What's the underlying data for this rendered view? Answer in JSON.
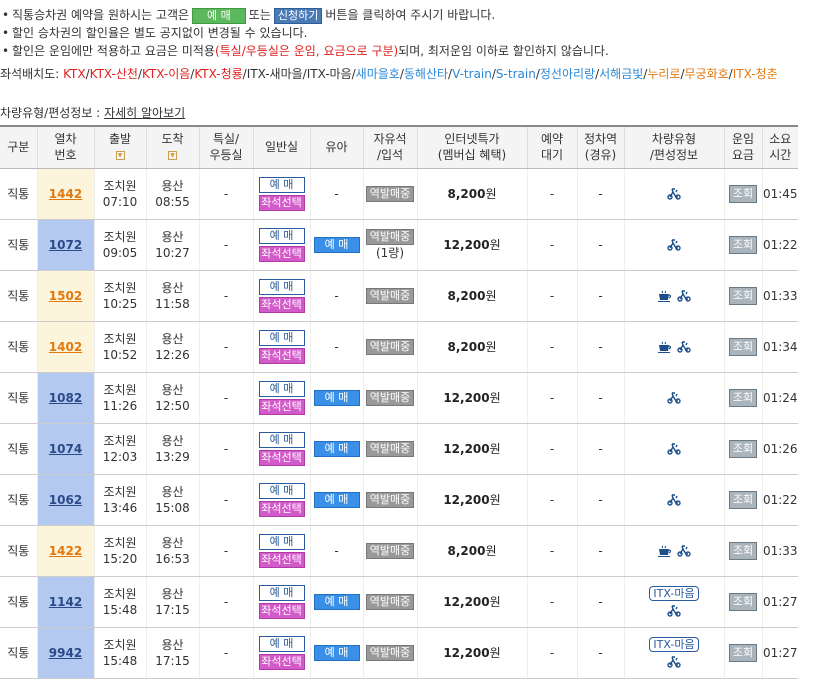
{
  "notes": {
    "line1_pre": "직통승차권 예약을 원하시는 고객은",
    "line1_btn1": "예 매",
    "line1_mid": "또는",
    "line1_btn2": "신청하기",
    "line1_post": "버튼을 클릭하여 주시기 바랍니다.",
    "line2": "할인 승차권의 할인율은 별도 공지없이 변경될 수 있습니다.",
    "line3_pre": "할인은 운임에만 적용하고 요금은 미적용",
    "line3_red": "(특실/우등실은 운임, 요금으로 구분)",
    "line3_post": "되며, 최저운임 이하로 할인하지 않습니다."
  },
  "legend": {
    "label": "좌석배치도:",
    "items": [
      {
        "text": "KTX",
        "color": "#e02020"
      },
      {
        "text": "KTX-산천",
        "color": "#e02020"
      },
      {
        "text": "KTX-이음",
        "color": "#e02020"
      },
      {
        "text": "KTX-청룡",
        "color": "#e02020"
      },
      {
        "text": "ITX-새마을",
        "color": "#333333"
      },
      {
        "text": "ITX-마음",
        "color": "#333333"
      },
      {
        "text": "새마을호",
        "color": "#2a88d8"
      },
      {
        "text": "동해산타",
        "color": "#2a88d8"
      },
      {
        "text": "V-train",
        "color": "#2a88d8"
      },
      {
        "text": "S-train",
        "color": "#2a88d8"
      },
      {
        "text": "정선아리랑",
        "color": "#2a88d8"
      },
      {
        "text": "서해금빛",
        "color": "#2a88d8"
      },
      {
        "text": "누리로",
        "color": "#e07a10"
      },
      {
        "text": "무궁화호",
        "color": "#e07a10"
      },
      {
        "text": "ITX-청춘",
        "color": "#e07a10"
      }
    ]
  },
  "car_type": {
    "label": "차량유형/편성정보 :",
    "link": "자세히 알아보기"
  },
  "headers": {
    "type": "구분",
    "train_no_1": "열차",
    "train_no_2": "번호",
    "depart": "출발",
    "arrive": "도착",
    "first_1": "특실/",
    "first_2": "우등실",
    "general": "일반실",
    "infant": "유아",
    "free_1": "자유석",
    "free_2": "/입석",
    "net_1": "인터넷특가",
    "net_2": "(멤버십 혜택)",
    "reserve_1": "예약",
    "reserve_2": "대기",
    "stop_1": "정차역",
    "stop_2": "(경유)",
    "vehicle_1": "차량유형",
    "vehicle_2": "/편성정보",
    "fare_1": "운임",
    "fare_2": "요금",
    "time_1": "소요",
    "time_2": "시간"
  },
  "labels": {
    "reserve": "예 매",
    "seat_select": "좌석선택",
    "station_sale": "역발매중",
    "lookup": "조회",
    "dash": "-",
    "won": "원"
  },
  "colors": {
    "orange_train": "#e07a10",
    "blue_train": "#2a4a8a",
    "seat_select": "#d35ac9",
    "reserve_filled": "#3a8fe6"
  },
  "rows": [
    {
      "type": "직통",
      "no": "1442",
      "style": "orange",
      "from": "조치원",
      "dep": "07:10",
      "to": "용산",
      "arr": "08:55",
      "first": "-",
      "infant": "-",
      "infant_btn": false,
      "free": "역발매중",
      "free_sub": "",
      "price": "8,200",
      "waitlist": "-",
      "stops": "-",
      "vehicle": "bike",
      "duration": "01:45"
    },
    {
      "type": "직통",
      "no": "1072",
      "style": "blue",
      "from": "조치원",
      "dep": "09:05",
      "to": "용산",
      "arr": "10:27",
      "first": "-",
      "infant": "예 매",
      "infant_btn": true,
      "free": "역발매중",
      "free_sub": "(1량)",
      "price": "12,200",
      "waitlist": "-",
      "stops": "-",
      "vehicle": "bike",
      "duration": "01:22"
    },
    {
      "type": "직통",
      "no": "1502",
      "style": "orange",
      "from": "조치원",
      "dep": "10:25",
      "to": "용산",
      "arr": "11:58",
      "first": "-",
      "infant": "-",
      "infant_btn": false,
      "free": "역발매중",
      "free_sub": "",
      "price": "8,200",
      "waitlist": "-",
      "stops": "-",
      "vehicle": "cafe-bike",
      "duration": "01:33"
    },
    {
      "type": "직통",
      "no": "1402",
      "style": "orange",
      "from": "조치원",
      "dep": "10:52",
      "to": "용산",
      "arr": "12:26",
      "first": "-",
      "infant": "-",
      "infant_btn": false,
      "free": "역발매중",
      "free_sub": "",
      "price": "8,200",
      "waitlist": "-",
      "stops": "-",
      "vehicle": "cafe-bike",
      "duration": "01:34"
    },
    {
      "type": "직통",
      "no": "1082",
      "style": "blue",
      "from": "조치원",
      "dep": "11:26",
      "to": "용산",
      "arr": "12:50",
      "first": "-",
      "infant": "예 매",
      "infant_btn": true,
      "free": "역발매중",
      "free_sub": "",
      "price": "12,200",
      "waitlist": "-",
      "stops": "-",
      "vehicle": "bike",
      "duration": "01:24"
    },
    {
      "type": "직통",
      "no": "1074",
      "style": "blue",
      "from": "조치원",
      "dep": "12:03",
      "to": "용산",
      "arr": "13:29",
      "first": "-",
      "infant": "예 매",
      "infant_btn": true,
      "free": "역발매중",
      "free_sub": "",
      "price": "12,200",
      "waitlist": "-",
      "stops": "-",
      "vehicle": "bike",
      "duration": "01:26"
    },
    {
      "type": "직통",
      "no": "1062",
      "style": "blue",
      "from": "조치원",
      "dep": "13:46",
      "to": "용산",
      "arr": "15:08",
      "first": "-",
      "infant": "예 매",
      "infant_btn": true,
      "free": "역발매중",
      "free_sub": "",
      "price": "12,200",
      "waitlist": "-",
      "stops": "-",
      "vehicle": "bike",
      "duration": "01:22"
    },
    {
      "type": "직통",
      "no": "1422",
      "style": "orange",
      "from": "조치원",
      "dep": "15:20",
      "to": "용산",
      "arr": "16:53",
      "first": "-",
      "infant": "-",
      "infant_btn": false,
      "free": "역발매중",
      "free_sub": "",
      "price": "8,200",
      "waitlist": "-",
      "stops": "-",
      "vehicle": "cafe-bike",
      "duration": "01:33"
    },
    {
      "type": "직통",
      "no": "1142",
      "style": "blue",
      "from": "조치원",
      "dep": "15:48",
      "to": "용산",
      "arr": "17:15",
      "first": "-",
      "infant": "예 매",
      "infant_btn": true,
      "free": "역발매중",
      "free_sub": "",
      "price": "12,200",
      "waitlist": "-",
      "stops": "-",
      "vehicle": "itx-bike",
      "vehicle_label": "ITX-마음",
      "duration": "01:27"
    },
    {
      "type": "직통",
      "no": "9942",
      "style": "blue",
      "from": "조치원",
      "dep": "15:48",
      "to": "용산",
      "arr": "17:15",
      "first": "-",
      "infant": "예 매",
      "infant_btn": true,
      "free": "역발매중",
      "free_sub": "",
      "price": "12,200",
      "waitlist": "-",
      "stops": "-",
      "vehicle": "itx-bike",
      "vehicle_label": "ITX-마음",
      "duration": "01:27"
    }
  ]
}
